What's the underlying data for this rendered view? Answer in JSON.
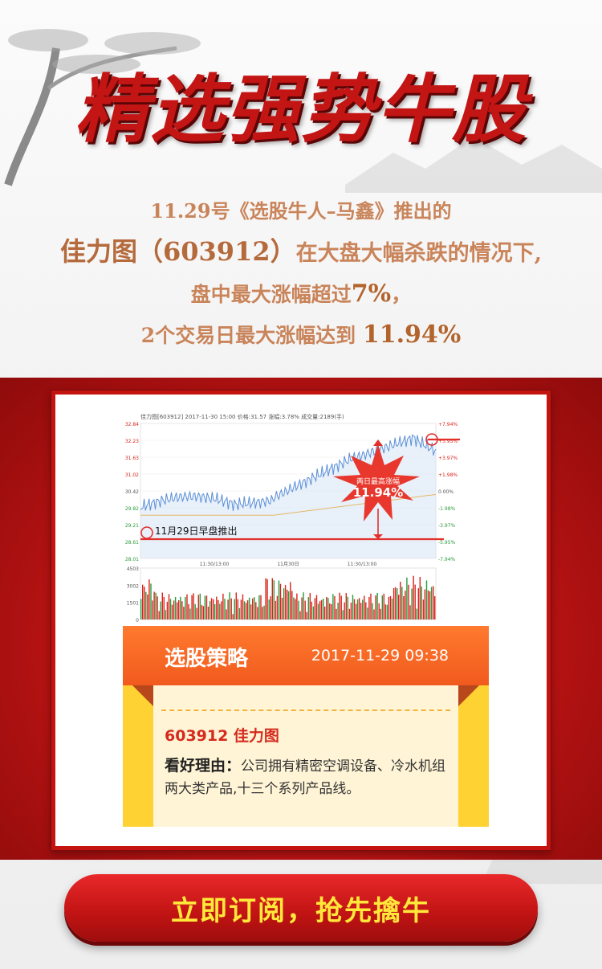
{
  "title": "精选强势牛股",
  "intro": {
    "line1": "11.29号《选股牛人–马鑫》推出的",
    "line2_name": "佳力图",
    "line2_code": "（603912）",
    "line2_rest": "在大盘大幅杀跌的情况下,",
    "line3_a": "盘中最大涨幅超过",
    "line3_pct": "7%",
    "line3_b": "，",
    "line4_a": "2个交易日最大涨幅达到 ",
    "line4_pct": "11.94%"
  },
  "chart": {
    "header": "佳力图[603912] 2017-11-30 15:00 价格:31.57 涨幅:3.78% 成交量:2189(手)",
    "annotation_push": "11月29日早盘推出",
    "burst_label": "两日最高涨幅",
    "burst_value": "11.94%",
    "price_ticks": [
      "32.84",
      "32.23",
      "31.63",
      "31.02",
      "30.42",
      "29.82",
      "29.21",
      "28.61",
      "28.01"
    ],
    "pct_ticks": [
      "+7.94%",
      "+5.95%",
      "+3.97%",
      "+1.98%",
      "0.00%",
      "-1.98%",
      "-3.97%",
      "-5.95%",
      "-7.94%"
    ],
    "x_ticks": [
      "11:30/13:00",
      "11月30日",
      "11:30/13:00"
    ],
    "volume_ticks": [
      "4503",
      "3002",
      "1501",
      "0"
    ],
    "colors": {
      "price_line": "#5b8fd6",
      "avg_line": "#e6b864",
      "accent": "#e2302a",
      "vol_up": "#d9241c",
      "vol_down": "#2a9a3a"
    }
  },
  "card": {
    "title": "选股策略",
    "time": "2017-11-29 09:38",
    "stock": "603912  佳力图",
    "reason_label": "看好理由：",
    "reason_text": "公司拥有精密空调设备、冷水机组两大类产品,十三个系列产品线。"
  },
  "cta": {
    "label": "立即订阅，抢先擒牛"
  }
}
